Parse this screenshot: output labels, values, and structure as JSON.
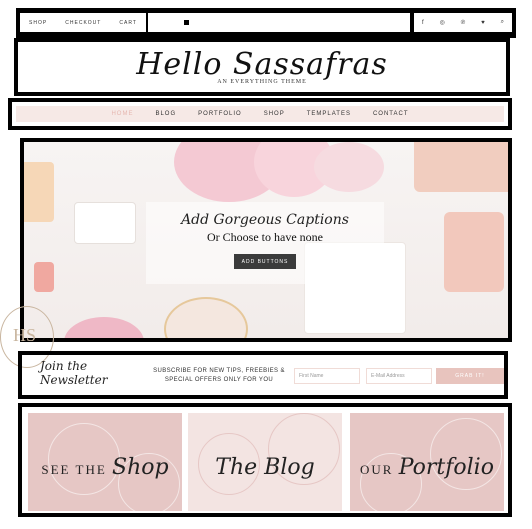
{
  "top_bar": {
    "nav_items": [
      "SHOP",
      "CHECKOUT",
      "CART"
    ],
    "social_icons": [
      "facebook-icon",
      "instagram-icon",
      "pinterest-icon",
      "twitter-icon",
      "search-icon"
    ]
  },
  "logo": {
    "title": "Hello Sassafras",
    "tagline": "AN EVERYTHING THEME"
  },
  "main_nav": {
    "items": [
      "HOME",
      "BLOG",
      "PORTFOLIO",
      "SHOP",
      "TEMPLATES",
      "CONTACT"
    ],
    "active_item": "HOME"
  },
  "hero": {
    "caption_script": "Add Gorgeous Captions",
    "caption_sub": "Or Choose to have none",
    "button_label": "ADD BUTTONS"
  },
  "stamp": {
    "text": "HS"
  },
  "newsletter": {
    "script": "Join the Newsletter",
    "text": "SUBSCRIBE FOR NEW TIPS, FREEBIES & SPECIAL OFFERS ONLY FOR YOU",
    "first_name_placeholder": "First Name",
    "email_placeholder": "E-Mail Address",
    "submit_label": "GRAB IT!"
  },
  "tiles": {
    "shop_prefix": "SEE THE",
    "shop_script": "Shop",
    "blog_script": "The Blog",
    "portfolio_prefix": "OUR",
    "portfolio_script": "Portfolio"
  },
  "colors": {
    "pink_bg": "#f6e9e6",
    "active_nav": "#e6b7b0",
    "tile_pink": "#e6c7c5",
    "button_dark": "#3b3b3b",
    "submit_pink": "#e8c4be"
  }
}
